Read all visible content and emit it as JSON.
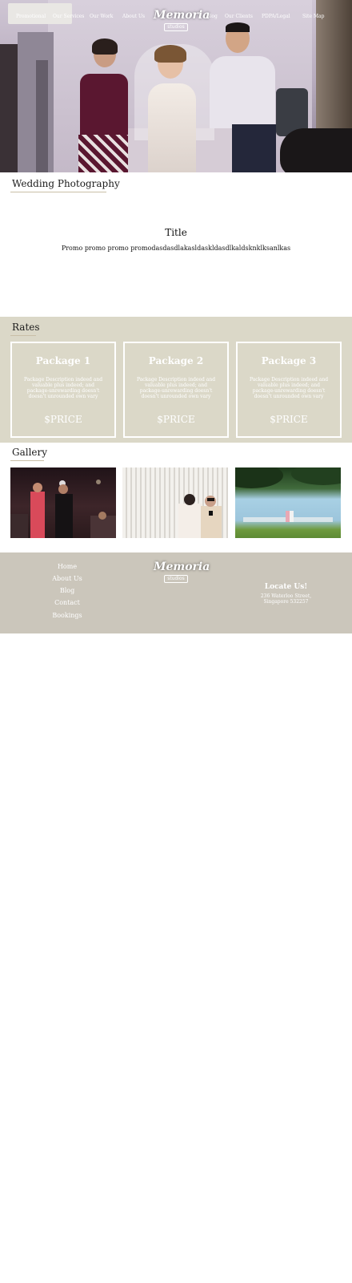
{
  "header": {
    "nav_left": [
      "Promotional",
      "Our Services",
      "Our Work",
      "About Us"
    ],
    "nav_right": [
      "Blog",
      "Our Clients",
      "PDPA/Legal",
      "Site Map"
    ],
    "logo_text": "Memoria",
    "logo_sub": "studios"
  },
  "services": {
    "section_title": "Wedding Photography"
  },
  "promo": {
    "title": "Title",
    "text": "Promo promo promo promodasdasdlakasldaskldasdlkaldsknklksanlkas"
  },
  "rates": {
    "section_title": "Rates",
    "packages": [
      {
        "name": "Package 1",
        "description": "Package Description indeed and valuable plus indeed; and package-unrewarding doesn't doesn't unrounded own vary",
        "price": "$PRICE"
      },
      {
        "name": "Package 2",
        "description": "Package Description indeed and valuable plus indeed; and package-unrewarding doesn't doesn't unrounded own vary",
        "price": "$PRICE"
      },
      {
        "name": "Package 3",
        "description": "Package Description indeed and valuable plus indeed; and package-unrewarding doesn't doesn't unrounded own vary",
        "price": "$PRICE"
      }
    ]
  },
  "gallery": {
    "section_title": "Gallery"
  },
  "footer": {
    "links": [
      "Home",
      "About Us",
      "Blog",
      "Contact",
      "Bookings"
    ],
    "logo_text": "Memoria",
    "logo_sub": "studios",
    "locate_title": "Locate Us!",
    "address_line1": "236 Waterloo Street,",
    "address_line2": "Singapore 532257"
  },
  "colors": {
    "rates_bg": "#dbd8c8",
    "footer_bg": "#cbc6bb",
    "underline": "#c9bfa7"
  }
}
